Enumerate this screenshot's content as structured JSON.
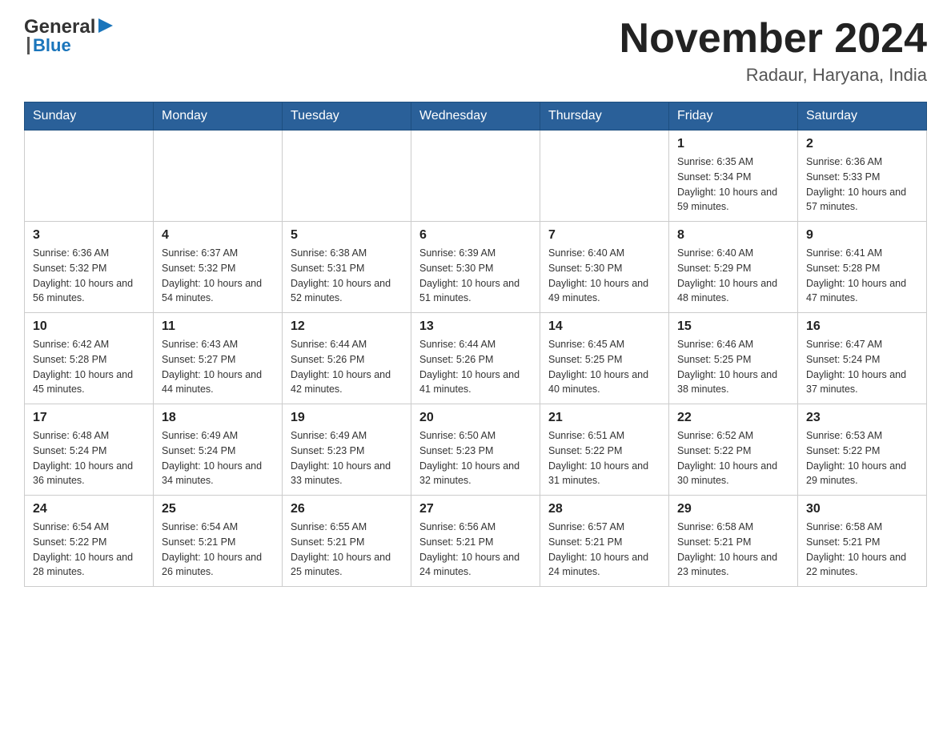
{
  "header": {
    "logo_general": "General",
    "logo_blue": "Blue",
    "title": "November 2024",
    "subtitle": "Radaur, Haryana, India"
  },
  "days_of_week": [
    "Sunday",
    "Monday",
    "Tuesday",
    "Wednesday",
    "Thursday",
    "Friday",
    "Saturday"
  ],
  "weeks": [
    [
      {
        "day": "",
        "info": ""
      },
      {
        "day": "",
        "info": ""
      },
      {
        "day": "",
        "info": ""
      },
      {
        "day": "",
        "info": ""
      },
      {
        "day": "",
        "info": ""
      },
      {
        "day": "1",
        "info": "Sunrise: 6:35 AM\nSunset: 5:34 PM\nDaylight: 10 hours and 59 minutes."
      },
      {
        "day": "2",
        "info": "Sunrise: 6:36 AM\nSunset: 5:33 PM\nDaylight: 10 hours and 57 minutes."
      }
    ],
    [
      {
        "day": "3",
        "info": "Sunrise: 6:36 AM\nSunset: 5:32 PM\nDaylight: 10 hours and 56 minutes."
      },
      {
        "day": "4",
        "info": "Sunrise: 6:37 AM\nSunset: 5:32 PM\nDaylight: 10 hours and 54 minutes."
      },
      {
        "day": "5",
        "info": "Sunrise: 6:38 AM\nSunset: 5:31 PM\nDaylight: 10 hours and 52 minutes."
      },
      {
        "day": "6",
        "info": "Sunrise: 6:39 AM\nSunset: 5:30 PM\nDaylight: 10 hours and 51 minutes."
      },
      {
        "day": "7",
        "info": "Sunrise: 6:40 AM\nSunset: 5:30 PM\nDaylight: 10 hours and 49 minutes."
      },
      {
        "day": "8",
        "info": "Sunrise: 6:40 AM\nSunset: 5:29 PM\nDaylight: 10 hours and 48 minutes."
      },
      {
        "day": "9",
        "info": "Sunrise: 6:41 AM\nSunset: 5:28 PM\nDaylight: 10 hours and 47 minutes."
      }
    ],
    [
      {
        "day": "10",
        "info": "Sunrise: 6:42 AM\nSunset: 5:28 PM\nDaylight: 10 hours and 45 minutes."
      },
      {
        "day": "11",
        "info": "Sunrise: 6:43 AM\nSunset: 5:27 PM\nDaylight: 10 hours and 44 minutes."
      },
      {
        "day": "12",
        "info": "Sunrise: 6:44 AM\nSunset: 5:26 PM\nDaylight: 10 hours and 42 minutes."
      },
      {
        "day": "13",
        "info": "Sunrise: 6:44 AM\nSunset: 5:26 PM\nDaylight: 10 hours and 41 minutes."
      },
      {
        "day": "14",
        "info": "Sunrise: 6:45 AM\nSunset: 5:25 PM\nDaylight: 10 hours and 40 minutes."
      },
      {
        "day": "15",
        "info": "Sunrise: 6:46 AM\nSunset: 5:25 PM\nDaylight: 10 hours and 38 minutes."
      },
      {
        "day": "16",
        "info": "Sunrise: 6:47 AM\nSunset: 5:24 PM\nDaylight: 10 hours and 37 minutes."
      }
    ],
    [
      {
        "day": "17",
        "info": "Sunrise: 6:48 AM\nSunset: 5:24 PM\nDaylight: 10 hours and 36 minutes."
      },
      {
        "day": "18",
        "info": "Sunrise: 6:49 AM\nSunset: 5:24 PM\nDaylight: 10 hours and 34 minutes."
      },
      {
        "day": "19",
        "info": "Sunrise: 6:49 AM\nSunset: 5:23 PM\nDaylight: 10 hours and 33 minutes."
      },
      {
        "day": "20",
        "info": "Sunrise: 6:50 AM\nSunset: 5:23 PM\nDaylight: 10 hours and 32 minutes."
      },
      {
        "day": "21",
        "info": "Sunrise: 6:51 AM\nSunset: 5:22 PM\nDaylight: 10 hours and 31 minutes."
      },
      {
        "day": "22",
        "info": "Sunrise: 6:52 AM\nSunset: 5:22 PM\nDaylight: 10 hours and 30 minutes."
      },
      {
        "day": "23",
        "info": "Sunrise: 6:53 AM\nSunset: 5:22 PM\nDaylight: 10 hours and 29 minutes."
      }
    ],
    [
      {
        "day": "24",
        "info": "Sunrise: 6:54 AM\nSunset: 5:22 PM\nDaylight: 10 hours and 28 minutes."
      },
      {
        "day": "25",
        "info": "Sunrise: 6:54 AM\nSunset: 5:21 PM\nDaylight: 10 hours and 26 minutes."
      },
      {
        "day": "26",
        "info": "Sunrise: 6:55 AM\nSunset: 5:21 PM\nDaylight: 10 hours and 25 minutes."
      },
      {
        "day": "27",
        "info": "Sunrise: 6:56 AM\nSunset: 5:21 PM\nDaylight: 10 hours and 24 minutes."
      },
      {
        "day": "28",
        "info": "Sunrise: 6:57 AM\nSunset: 5:21 PM\nDaylight: 10 hours and 24 minutes."
      },
      {
        "day": "29",
        "info": "Sunrise: 6:58 AM\nSunset: 5:21 PM\nDaylight: 10 hours and 23 minutes."
      },
      {
        "day": "30",
        "info": "Sunrise: 6:58 AM\nSunset: 5:21 PM\nDaylight: 10 hours and 22 minutes."
      }
    ]
  ]
}
